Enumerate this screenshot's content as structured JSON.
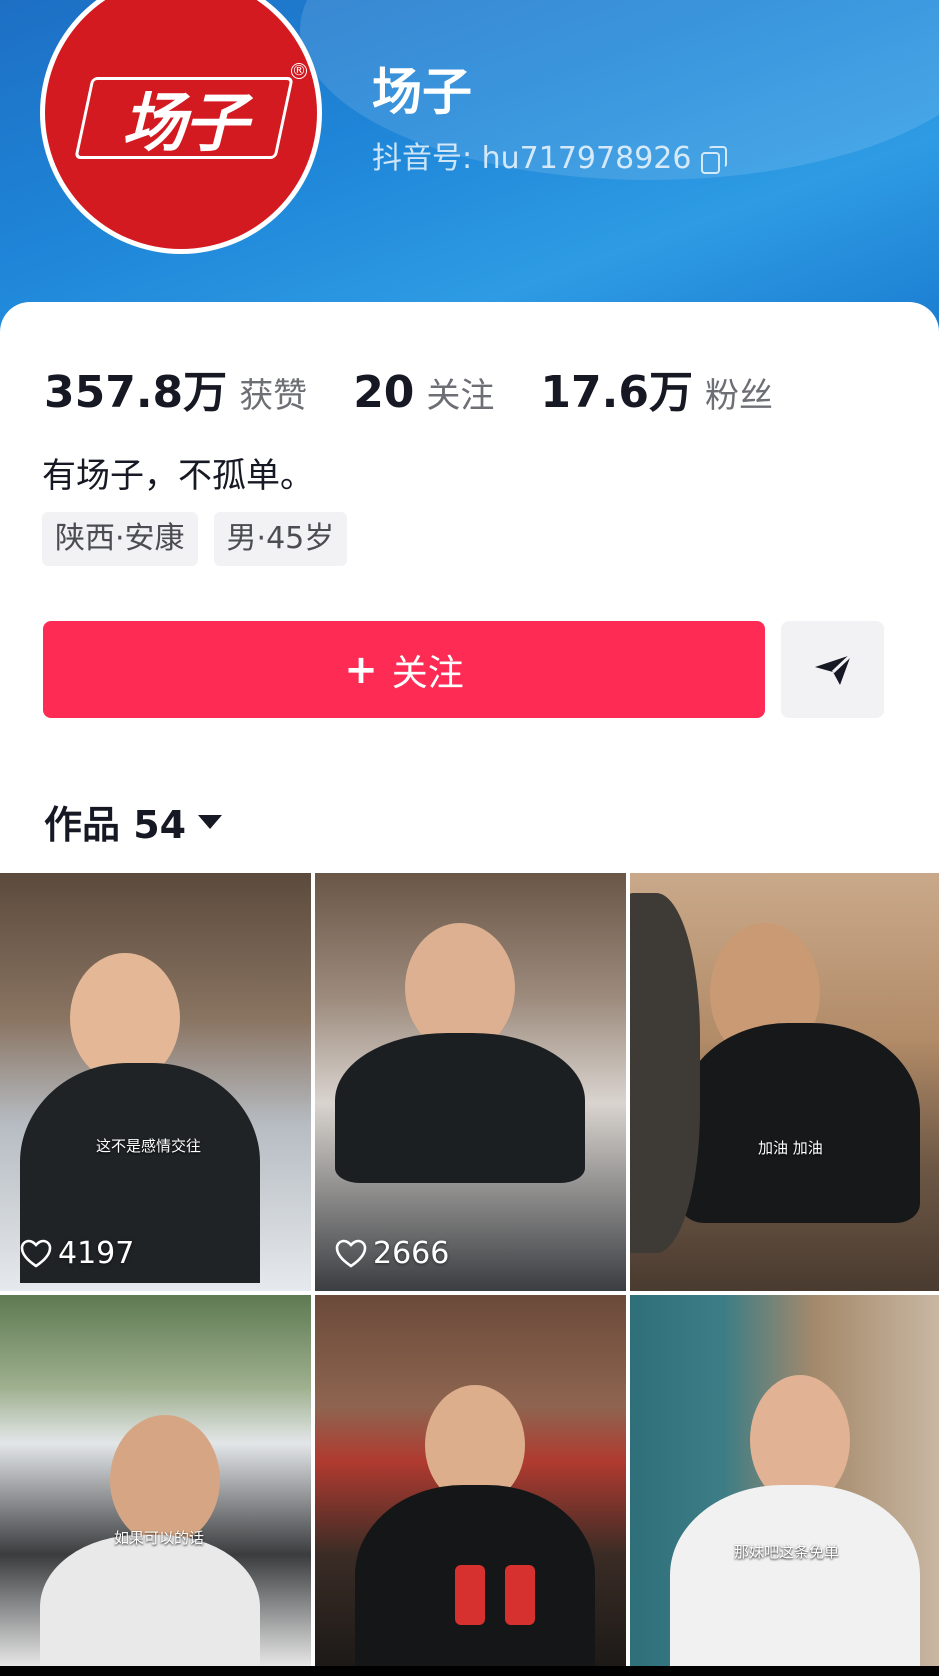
{
  "profile": {
    "logo_text": "场子",
    "name": "场子",
    "douyin_id": "抖音号: hu717978926"
  },
  "stats": [
    {
      "value": "357.8万",
      "label": "获赞"
    },
    {
      "value": "20",
      "label": "关注"
    },
    {
      "value": "17.6万",
      "label": "粉丝"
    }
  ],
  "bio": "有场子，不孤单。",
  "tags": [
    "陕西·安康",
    "男·45岁"
  ],
  "actions": {
    "follow_label": "关注",
    "share_icon": "send-icon"
  },
  "works_tab": {
    "label": "作品 54"
  },
  "videos": [
    {
      "likes": "4197",
      "subtitle": "这不是感情交往"
    },
    {
      "likes": "2666",
      "subtitle": ""
    },
    {
      "likes": "",
      "subtitle": "加油 加油"
    },
    {
      "likes": "",
      "subtitle": "如果可以的话"
    },
    {
      "likes": "",
      "subtitle": ""
    },
    {
      "likes": "",
      "subtitle": "那妹吧这条免单"
    }
  ],
  "colors": {
    "accent": "#fe2c55",
    "header": "#1f86d8",
    "logo_red": "#d31a20"
  }
}
